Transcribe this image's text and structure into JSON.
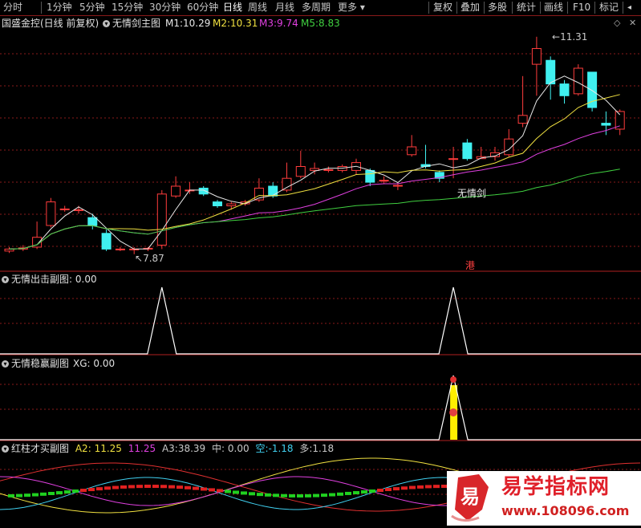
{
  "toolbar": {
    "periods": [
      "分时",
      "1分钟",
      "5分钟",
      "15分钟",
      "30分钟",
      "60分钟",
      "日线",
      "周线",
      "月线",
      "多周期",
      "更多"
    ],
    "active_period": "日线",
    "right": [
      "复权",
      "叠加",
      "多股",
      "统计",
      "画线",
      "F10",
      "标记"
    ]
  },
  "main_panel": {
    "stock_title": "国盛金控(日线 前复权)",
    "indicator_name": "无情剑主图",
    "ma": [
      {
        "label": "M1:",
        "value": "10.29",
        "color": "#e8e8e8"
      },
      {
        "label": "M2:",
        "value": "10.31",
        "color": "#f0e040"
      },
      {
        "label": "M3:",
        "value": "9.74",
        "color": "#e040e0"
      },
      {
        "label": "M5:",
        "value": "8.83",
        "color": "#40d040"
      }
    ],
    "high_label": "11.31",
    "low_label": "7.87",
    "signal_text": "无情剑",
    "hk_badge": "港"
  },
  "sub1": {
    "title": "无情出击副图",
    "value_label": ": 0.00"
  },
  "sub2": {
    "title": "无情稳赢副图",
    "value_label": "XG: 0.00"
  },
  "sub3": {
    "title": "红柱才买副图",
    "items": [
      {
        "label": "A2:",
        "value": "11.25",
        "color": "#f0e040"
      },
      {
        "label": "",
        "value": "11.25",
        "color": "#e040e0"
      },
      {
        "label": "A3:",
        "value": "38.39",
        "color": "#c8c8c8"
      },
      {
        "label": "中:",
        "value": "0.00",
        "color": "#c8c8c8"
      },
      {
        "label": "空:",
        "value": "-1.18",
        "color": "#40d0f0"
      },
      {
        "label": "多:",
        "value": "1.18",
        "color": "#c8c8c8"
      }
    ]
  },
  "watermark": {
    "brand": "易学指标网",
    "url": "www.108096.com",
    "logo_char": "易"
  },
  "colors": {
    "up": "#ff3c3c",
    "down": "#40f0f0",
    "grid": "#8a1a1a",
    "panel_border": "#b02020"
  },
  "chart_data": {
    "type": "candlestick",
    "candles": [
      [
        7.95,
        8.0,
        8.05,
        7.9
      ],
      [
        8.0,
        8.03,
        8.1,
        7.95
      ],
      [
        8.05,
        8.3,
        8.7,
        8.0
      ],
      [
        8.6,
        9.2,
        9.3,
        8.55
      ],
      [
        9.0,
        9.02,
        9.1,
        8.95
      ],
      [
        9.0,
        9.0,
        9.1,
        8.9
      ],
      [
        8.8,
        8.6,
        8.9,
        8.5
      ],
      [
        8.4,
        8.0,
        8.5,
        7.95
      ],
      [
        8.0,
        8.0,
        8.05,
        7.95
      ],
      [
        7.98,
        8.0,
        8.05,
        7.87
      ],
      [
        8.0,
        8.02,
        8.05,
        7.95
      ],
      [
        8.1,
        9.4,
        9.5,
        8.0
      ],
      [
        9.35,
        9.6,
        9.85,
        9.3
      ],
      [
        9.5,
        9.5,
        9.7,
        9.4
      ],
      [
        9.55,
        9.4,
        9.6,
        9.35
      ],
      [
        9.2,
        9.1,
        9.25,
        9.05
      ],
      [
        9.1,
        9.15,
        9.2,
        9.0
      ],
      [
        9.15,
        9.2,
        9.25,
        9.1
      ],
      [
        9.25,
        9.55,
        9.8,
        9.2
      ],
      [
        9.6,
        9.35,
        9.7,
        9.3
      ],
      [
        9.5,
        9.8,
        10.2,
        9.45
      ],
      [
        9.85,
        10.1,
        10.5,
        9.8
      ],
      [
        10.0,
        10.05,
        10.2,
        9.9
      ],
      [
        10.0,
        10.02,
        10.1,
        9.95
      ],
      [
        10.0,
        10.1,
        10.15,
        9.95
      ],
      [
        10.0,
        10.2,
        10.3,
        9.9
      ],
      [
        10.0,
        9.7,
        10.05,
        9.6
      ],
      [
        9.75,
        9.75,
        9.85,
        9.65
      ],
      [
        9.6,
        9.62,
        9.7,
        9.5
      ],
      [
        10.4,
        10.6,
        10.9,
        10.35
      ],
      [
        10.15,
        10.1,
        10.65,
        10.05
      ],
      [
        9.95,
        9.8,
        10.0,
        9.7
      ],
      [
        10.3,
        10.3,
        10.6,
        9.8
      ],
      [
        10.7,
        10.3,
        10.8,
        10.25
      ],
      [
        10.3,
        10.35,
        10.6,
        10.3
      ],
      [
        10.35,
        10.45,
        10.6,
        10.25
      ],
      [
        10.4,
        10.8,
        11.05,
        10.35
      ],
      [
        11.2,
        11.4,
        12.4,
        11.1
      ],
      [
        12.7,
        13.1,
        13.4,
        11.9
      ],
      [
        12.8,
        12.2,
        12.9,
        11.8
      ],
      [
        12.2,
        11.9,
        12.3,
        11.7
      ],
      [
        11.95,
        12.6,
        12.7,
        11.9
      ],
      [
        12.5,
        11.6,
        12.5,
        11.5
      ],
      [
        11.2,
        11.15,
        11.5,
        10.9
      ],
      [
        11.05,
        11.5,
        11.55,
        10.9
      ]
    ],
    "ylim": [
      7.6,
      13.6
    ],
    "high_marker": 11.31,
    "low_marker": 7.87
  }
}
